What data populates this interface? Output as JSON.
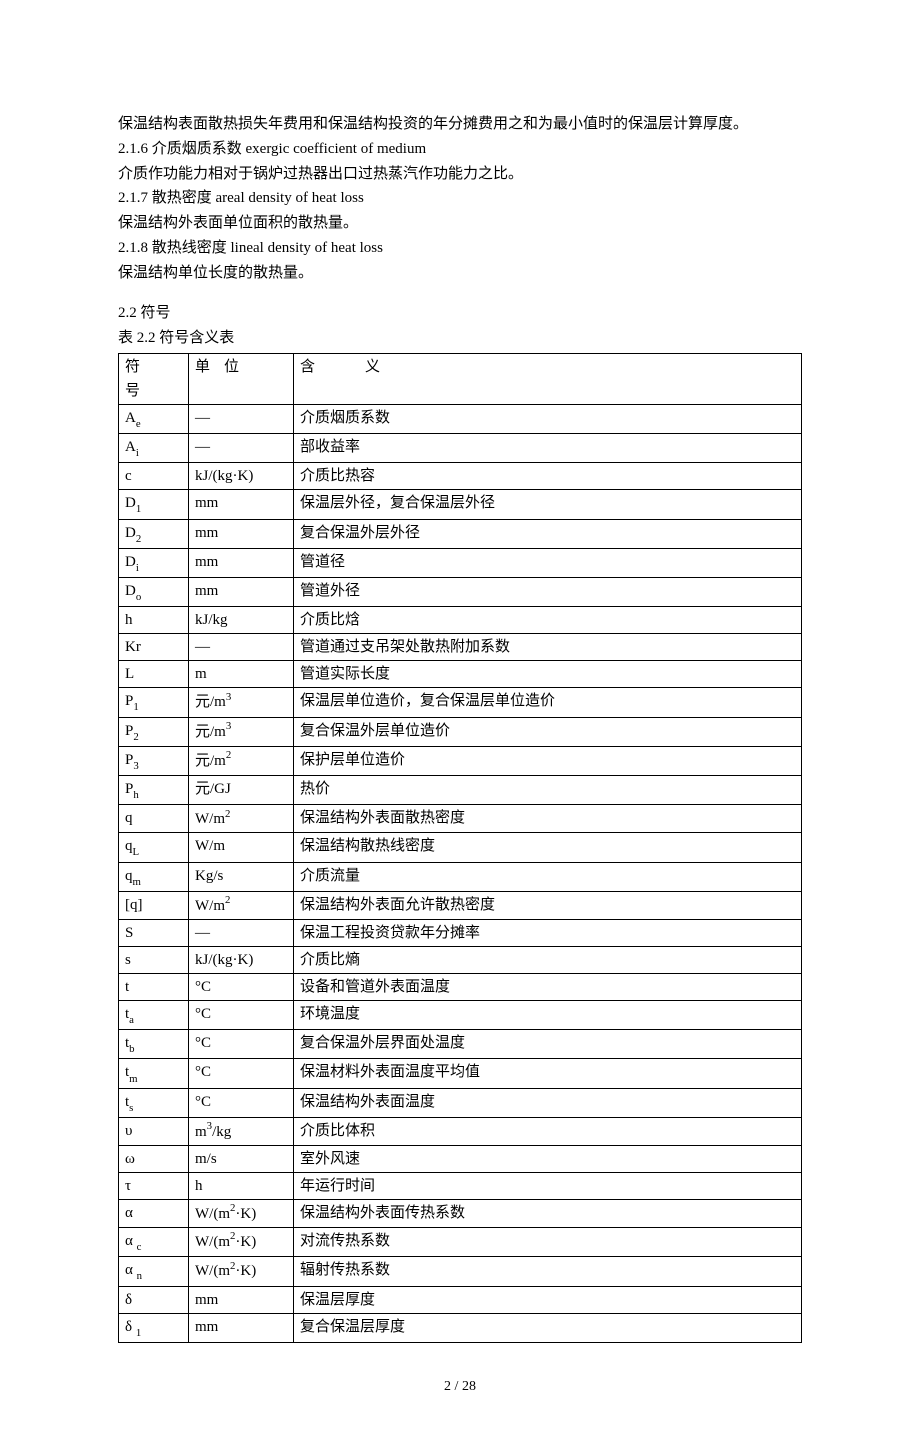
{
  "intro": {
    "p1": "保温结构表面散热损失年费用和保温结构投资的年分摊费用之和为最小值时的保温层计算厚度。",
    "h216": "2.1.6 介质烟质系数 exergic coefficient of medium",
    "p216": "介质作功能力相对于锅炉过热器出口过热蒸汽作功能力之比。",
    "h217": "2.1.7 散热密度 areal density of heat loss",
    "p217": "保温结构外表面单位面积的散热量。",
    "h218": "2.1.8 散热线密度 lineal density of heat loss",
    "p218": "保温结构单位长度的散热量。"
  },
  "section22": {
    "heading": "2.2 符号",
    "caption": "表 2.2 符号含义表",
    "headers": {
      "col1": "符号",
      "col2": "单位",
      "col3": "含义"
    }
  },
  "rows": [
    {
      "sym": "A",
      "sub": "e",
      "unit": "—",
      "mean": "介质烟质系数"
    },
    {
      "sym": "A",
      "sub": "i",
      "unit": "—",
      "mean": "部收益率"
    },
    {
      "sym": "c",
      "sub": "",
      "unit": "kJ/(kg·K)",
      "mean": "介质比热容"
    },
    {
      "sym": "D",
      "sub": "1",
      "unit": "mm",
      "mean": "保温层外径，复合保温层外径"
    },
    {
      "sym": "D",
      "sub": "2",
      "unit": "mm",
      "mean": "复合保温外层外径"
    },
    {
      "sym": "D",
      "sub": "i",
      "unit": "mm",
      "mean": "管道径"
    },
    {
      "sym": "D",
      "sub": "o",
      "unit": "mm",
      "mean": "管道外径"
    },
    {
      "sym": "h",
      "sub": "",
      "unit": "kJ/kg",
      "mean": "介质比焓"
    },
    {
      "sym": "Kr",
      "sub": "",
      "unit": "—",
      "mean": "管道通过支吊架处散热附加系数"
    },
    {
      "sym": "L",
      "sub": "",
      "unit": "m",
      "mean": "管道实际长度"
    },
    {
      "sym": "P",
      "sub": "1",
      "unit": "元/m",
      "usup": "3",
      "mean": "保温层单位造价，复合保温层单位造价"
    },
    {
      "sym": "P",
      "sub": "2",
      "unit": "元/m",
      "usup": "3",
      "mean": "复合保温外层单位造价"
    },
    {
      "sym": "P",
      "sub": "3",
      "unit": "元/m",
      "usup": "2",
      "mean": "保护层单位造价"
    },
    {
      "sym": "P",
      "sub": "h",
      "unit": "元/GJ",
      "mean": "热价"
    },
    {
      "sym": "q",
      "sub": "",
      "unit": "W/m",
      "usup": "2",
      "mean": "保温结构外表面散热密度"
    },
    {
      "sym": "q",
      "sub": "L",
      "unit": "W/m",
      "mean": "保温结构散热线密度"
    },
    {
      "sym": "q",
      "sub": "m",
      "unit": "Kg/s",
      "mean": "介质流量"
    },
    {
      "sym": "[q]",
      "sub": "",
      "unit": "W/m",
      "usup": "2",
      "mean": "保温结构外表面允许散热密度"
    },
    {
      "sym": "S",
      "sub": "",
      "unit": "—",
      "mean": "保温工程投资贷款年分摊率"
    },
    {
      "sym": "s",
      "sub": "",
      "unit": "kJ/(kg·K)",
      "mean": "介质比熵"
    },
    {
      "sym": "t",
      "sub": "",
      "unit": "°C",
      "mean": "设备和管道外表面温度"
    },
    {
      "sym": "t",
      "sub": "a",
      "unit": "°C",
      "mean": "环境温度"
    },
    {
      "sym": "t",
      "sub": "b",
      "unit": "°C",
      "mean": "复合保温外层界面处温度"
    },
    {
      "sym": "t",
      "sub": "m",
      "unit": "°C",
      "mean": "保温材料外表面温度平均值"
    },
    {
      "sym": "t",
      "sub": "s",
      "unit": "°C",
      "mean": "保温结构外表面温度"
    },
    {
      "sym": "υ",
      "sub": "",
      "unit": "m",
      "usup": "3",
      "utail": "/kg",
      "mean": "介质比体积"
    },
    {
      "sym": "ω",
      "sub": "",
      "unit": "m/s",
      "mean": "室外风速"
    },
    {
      "sym": "τ",
      "sub": "",
      "unit": "h",
      "mean": "年运行时间"
    },
    {
      "sym": "α",
      "sub": "",
      "unit": "W/(m",
      "usup": "2",
      "utail": "·K)",
      "mean": "保温结构外表面传热系数"
    },
    {
      "sym": "α",
      "sub": "c",
      "subspace": true,
      "unit": "W/(m",
      "usup": "2",
      "utail": "·K)",
      "mean": "对流传热系数"
    },
    {
      "sym": "α",
      "sub": "n",
      "subspace": true,
      "unit": "W/(m",
      "usup": "2",
      "utail": "·K)",
      "mean": "辐射传热系数"
    },
    {
      "sym": "δ",
      "sub": "",
      "unit": "mm",
      "mean": "保温层厚度"
    },
    {
      "sym": "δ",
      "sub": "1",
      "subspace": true,
      "unit": "mm",
      "mean": "复合保温层厚度"
    }
  ],
  "page": {
    "current": "2",
    "sep": " / ",
    "total": "28"
  }
}
